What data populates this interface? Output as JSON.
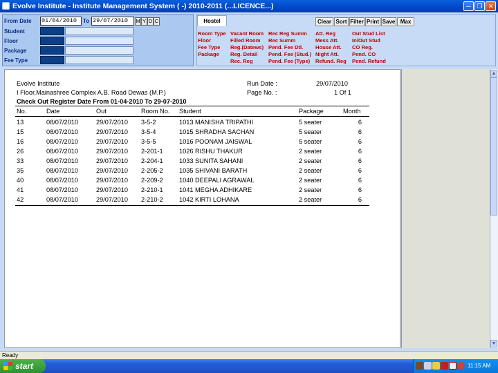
{
  "window": {
    "title": "Evolve Institute - Institute Management System ( -) 2010-2011 (...LICENCE...)"
  },
  "filters": {
    "from_label": "From Date",
    "from_value": "01/04/2010",
    "to_label": "To",
    "to_value": "29/07/2010",
    "quick_buttons": [
      "M",
      "Y",
      "D",
      "C"
    ],
    "student_label": "Student",
    "floor_label": "Floor",
    "package_label": "Package",
    "fee_type_label": "Fee Type"
  },
  "hostel": {
    "tab_label": "Hostel",
    "toolbar": [
      "Clear",
      "Sort",
      "Filter",
      "Print",
      "Save",
      "Max"
    ],
    "menu": [
      [
        "Room Type",
        "Floor",
        "Fee Type",
        "Package"
      ],
      [
        "Vacant Room",
        "Filled Room",
        "Reg.(Datews)",
        "Reg. Detail",
        "Rec. Reg"
      ],
      [
        "Rec Reg Summ",
        "Rec Summ",
        "Pend. Fee Dtl.",
        "Pend. Fee (Stud.)",
        "Pend. Fee (Type)"
      ],
      [
        "Att. Reg",
        "Mess Att.",
        "House Att.",
        "Night Att.",
        "Refund. Reg"
      ],
      [
        "Out Stud List",
        "In/Out Stud",
        "CO Reg.",
        "Pend. CO",
        "Pend. Refund"
      ]
    ]
  },
  "report": {
    "institute": "Evolve Institute",
    "address": "I Floor,Mainashree Complex A.B. Road Dewas (M.P.)",
    "run_date_label": "Run Date :",
    "run_date": "29/07/2010",
    "page_label": "Page No. :",
    "page_value": "1 Of 1",
    "title": "Check Out Register Date From 01-04-2010 To 29-07-2010",
    "columns": [
      "No.",
      "Date",
      "Out",
      "Room No.",
      "Student",
      "Package",
      "Month"
    ],
    "rows": [
      [
        "13",
        "08/07/2010",
        "29/07/2010",
        "3-5-2",
        "1013  MANISHA  TRIPATHI",
        "5 seater",
        "6"
      ],
      [
        "15",
        "08/07/2010",
        "29/07/2010",
        "3-5-4",
        "1015  SHRADHA  SACHAN",
        "5 seater",
        "6"
      ],
      [
        "16",
        "08/07/2010",
        "29/07/2010",
        "3-5-5",
        "1016  POONAM  JAISWAL",
        "5 seater",
        "6"
      ],
      [
        "26",
        "08/07/2010",
        "29/07/2010",
        "2-201-1",
        "1026  RISHU  THAKUR",
        "2 seater",
        "6"
      ],
      [
        "33",
        "08/07/2010",
        "29/07/2010",
        "2-204-1",
        "1033  SUNITA  SAHANI",
        "2 seater",
        "6"
      ],
      [
        "35",
        "08/07/2010",
        "29/07/2010",
        "2-205-2",
        "1035  SHIVANI  BARATH",
        "2 seater",
        "6"
      ],
      [
        "40",
        "08/07/2010",
        "29/07/2010",
        "2-209-2",
        "1040  DEEPALI  AGRAWAL",
        "2 seater",
        "6"
      ],
      [
        "41",
        "08/07/2010",
        "29/07/2010",
        "2-210-1",
        "1041  MEGHA  ADHIKARE",
        "2 seater",
        "6"
      ],
      [
        "42",
        "08/07/2010",
        "29/07/2010",
        "2-210-2",
        "1042  KIRTI  LOHANA",
        "2 seater",
        "6"
      ]
    ]
  },
  "status": {
    "text": "Ready"
  },
  "taskbar": {
    "start_label": "start",
    "clock": "11:15 AM"
  }
}
